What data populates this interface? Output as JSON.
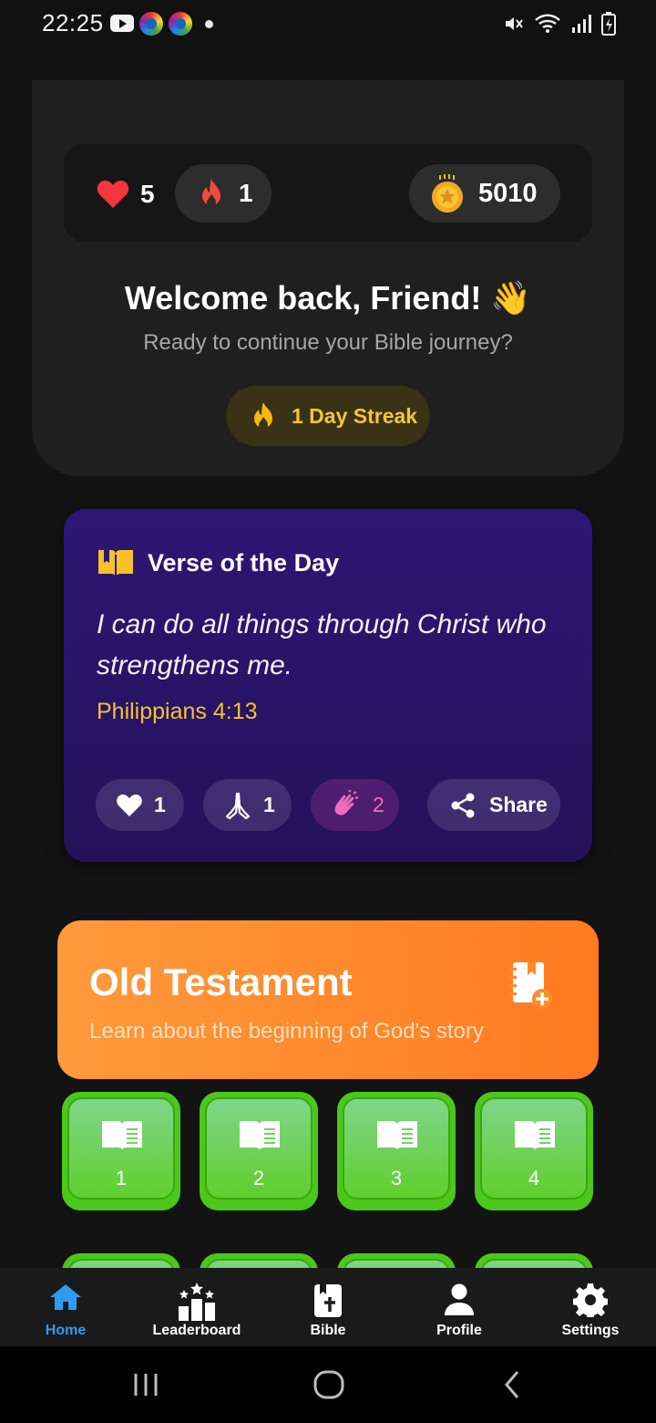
{
  "status_bar": {
    "time": "22:25",
    "icons": [
      "youtube-icon",
      "app-icon",
      "app-icon",
      "notification-dot",
      "mute-icon",
      "wifi-icon",
      "signal-icon",
      "battery-icon"
    ]
  },
  "stats": {
    "hearts": "5",
    "streak_count": "1",
    "coins": "5010"
  },
  "welcome": {
    "title": "Welcome back, Friend! 👋",
    "subtitle": "Ready to continue your Bible journey?",
    "streak_label": "1 Day Streak"
  },
  "verse": {
    "heading": "Verse of the Day",
    "text": "I can do all things through Christ who strengthens me.",
    "reference": "Philippians 4:13",
    "reactions": {
      "like": "1",
      "pray": "1",
      "clap": "2",
      "share_label": "Share"
    }
  },
  "old_testament": {
    "title": "Old Testament",
    "subtitle": "Learn about the beginning of God's story",
    "lessons": [
      "1",
      "2",
      "3",
      "4"
    ]
  },
  "bottom_nav": {
    "items": [
      {
        "label": "Home",
        "icon": "home-icon",
        "active": true
      },
      {
        "label": "Leaderboard",
        "icon": "leaderboard-icon",
        "active": false
      },
      {
        "label": "Bible",
        "icon": "bible-icon",
        "active": false
      },
      {
        "label": "Profile",
        "icon": "profile-icon",
        "active": false
      },
      {
        "label": "Settings",
        "icon": "gear-icon",
        "active": false
      }
    ]
  },
  "colors": {
    "accent_blue": "#2f9bef",
    "streak_gold": "#f7c531",
    "verse_purple": "#2e1674",
    "testament_orange": "#ff8a2c",
    "lesson_green": "#4cc71c"
  }
}
